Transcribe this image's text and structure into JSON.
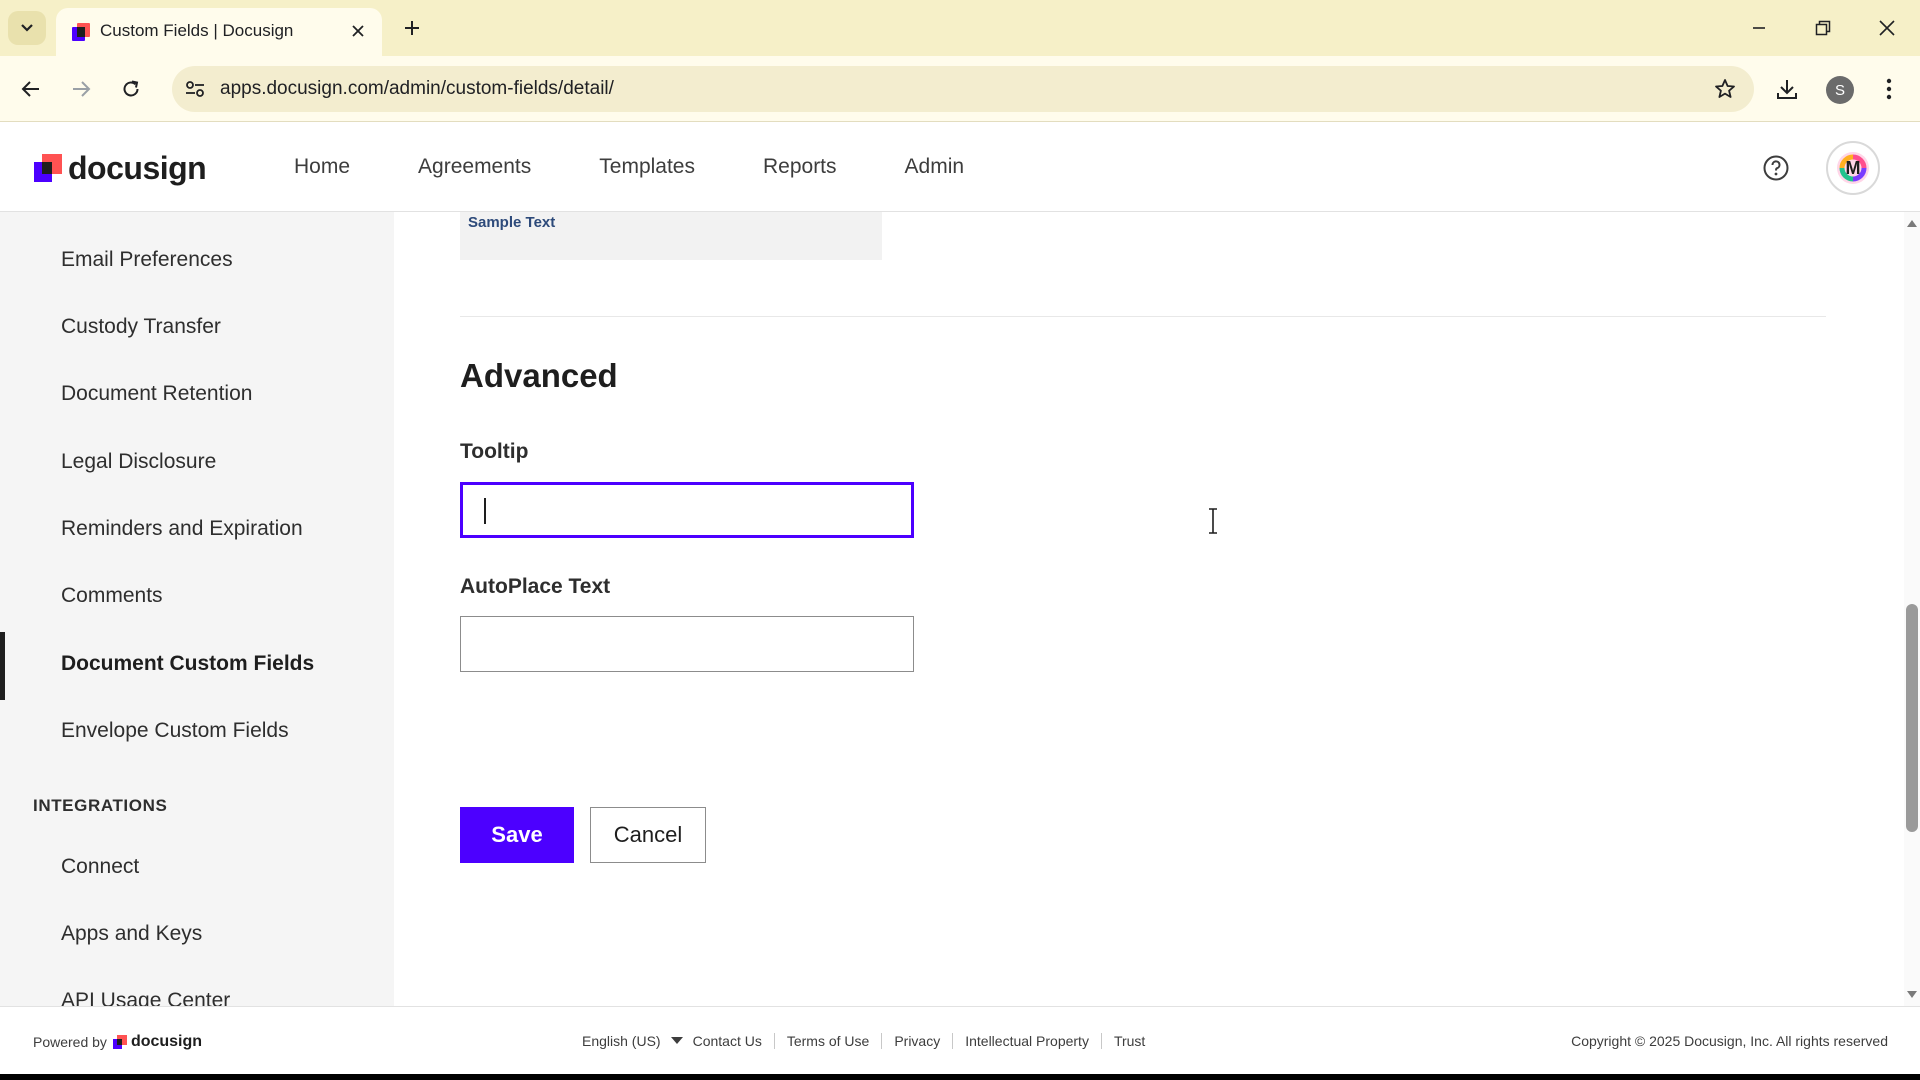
{
  "browser": {
    "tab_title": "Custom Fields | Docusign",
    "url": "apps.docusign.com/admin/custom-fields/detail/",
    "profile_initial": "S"
  },
  "header": {
    "logo_text": "docusign",
    "nav": [
      "Home",
      "Agreements",
      "Templates",
      "Reports",
      "Admin"
    ],
    "avatar_initial": "M"
  },
  "sidebar": {
    "items": [
      "Email Preferences",
      "Custody Transfer",
      "Document Retention",
      "Legal Disclosure",
      "Reminders and Expiration",
      "Comments",
      "Document Custom Fields",
      "Envelope Custom Fields"
    ],
    "active_item": "Document Custom Fields",
    "integrations_heading": "INTEGRATIONS",
    "integration_items": [
      "Connect",
      "Apps and Keys",
      "API Usage Center"
    ]
  },
  "main": {
    "sample_text": "Sample Text",
    "section_title": "Advanced",
    "tooltip_label": "Tooltip",
    "tooltip_value": "",
    "autoplace_label": "AutoPlace Text",
    "autoplace_value": "",
    "save_label": "Save",
    "cancel_label": "Cancel"
  },
  "footer": {
    "powered_by": "Powered by",
    "brand": "docusign",
    "language": "English (US)",
    "links": [
      "Contact Us",
      "Terms of Use",
      "Privacy",
      "Intellectual Property",
      "Trust"
    ],
    "copyright": "Copyright © 2025 Docusign, Inc. All rights reserved"
  },
  "colors": {
    "accent": "#4c00ff",
    "tab_strip": "#f6f0c8",
    "sidebar_bg": "#f5f5f5"
  }
}
